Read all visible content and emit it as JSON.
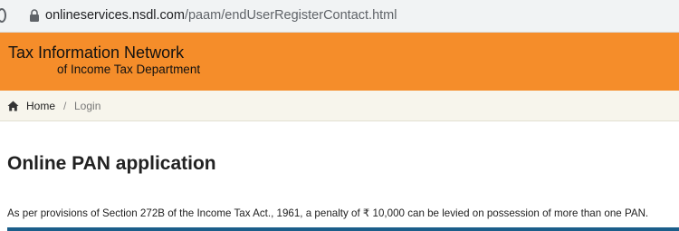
{
  "browser": {
    "url_host": "onlineservices.nsdl.com",
    "url_path": "/paam/endUserRegisterContact.html",
    "icons": {
      "reload": "reload-icon",
      "lock": "lock-icon"
    }
  },
  "header": {
    "title": "Tax Information Network",
    "subtitle": "of Income Tax Department",
    "background_color": "#f58d2a"
  },
  "breadcrumb": {
    "home_icon": "home-icon",
    "home_label": "Home",
    "separator": "/",
    "current": "Login"
  },
  "main": {
    "title": "Online PAN application",
    "notice": "As per provisions of Section 272B of the Income Tax Act., 1961, a penalty of ₹ 10,000 can be levied on possession of more than one PAN."
  }
}
